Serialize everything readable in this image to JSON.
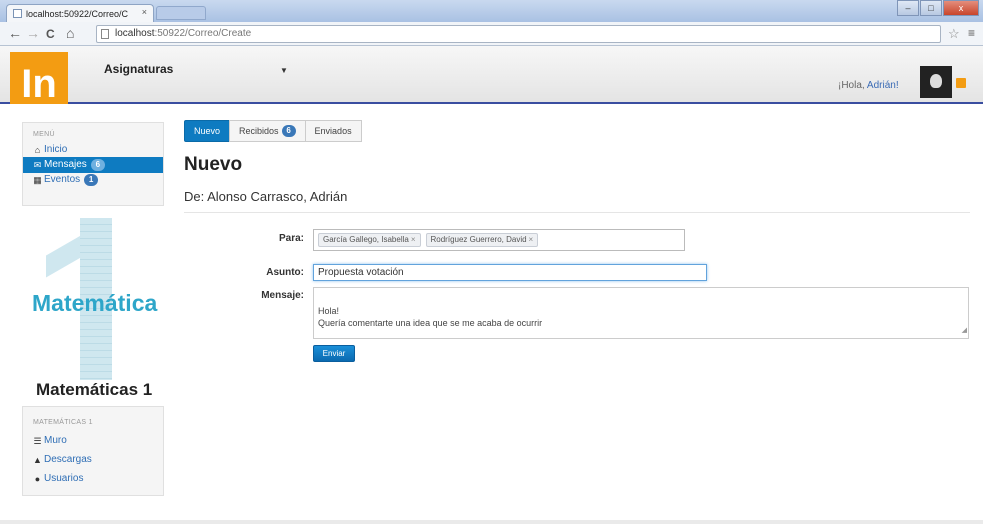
{
  "browser": {
    "tab_title": "localhost:50922/Correo/C",
    "tab_close": "×",
    "url_host": "localhost",
    "url_path": ":50922/Correo/Create",
    "nav_back": "←",
    "nav_forward": "→",
    "nav_reload": "C",
    "nav_home": "⌂",
    "star": "☆",
    "menu": "≡",
    "minimize": "–",
    "maximize": "□",
    "close": "x"
  },
  "navbar": {
    "logo_text": "In",
    "brand": "Asignaturas",
    "caret": "▼",
    "greeting": "¡Hola, ",
    "user_name": "Adrián!"
  },
  "sidebar": {
    "menu_heading": "MENÚ",
    "items": [
      {
        "label": "Inicio",
        "icon": "home-icon",
        "glyph": "⌂"
      },
      {
        "label": "Mensajes",
        "icon": "envelope-icon",
        "glyph": "✉",
        "badge": "6",
        "active": true
      },
      {
        "label": "Eventos",
        "icon": "calendar-icon",
        "glyph": "▦",
        "badge": "1"
      }
    ],
    "subject_graphic_label": "Matemática",
    "subject_title": "Matemáticas 1",
    "course_heading": "MATEMÁTICAS 1",
    "course_items": [
      {
        "label": "Muro",
        "icon": "list-icon",
        "glyph": "☰"
      },
      {
        "label": "Descargas",
        "icon": "download-icon",
        "glyph": "▲"
      },
      {
        "label": "Usuarios",
        "icon": "user-icon",
        "glyph": "●"
      }
    ]
  },
  "tabs": [
    {
      "label": "Nuevo",
      "active": true
    },
    {
      "label": "Recibidos",
      "badge": "6"
    },
    {
      "label": "Enviados"
    }
  ],
  "main": {
    "title": "Nuevo",
    "from_line": "De: Alonso Carrasco, Adrián",
    "to_label": "Para:",
    "recipients": [
      "García Gallego, Isabella",
      "Rodríguez Guerrero, David"
    ],
    "chip_remove": "×",
    "subject_label": "Asunto:",
    "subject_value": "Propuesta votación",
    "message_label": "Mensaje:",
    "message_value": "Hola!\nQuería comentarte una idea que se me acaba de ocurrir",
    "send_label": "Enviar"
  },
  "colors": {
    "accent": "#0e7bc1",
    "logo": "#f39c12",
    "subject_graphic": "#2ea6c9",
    "navbar_border": "#3a4ea0"
  }
}
